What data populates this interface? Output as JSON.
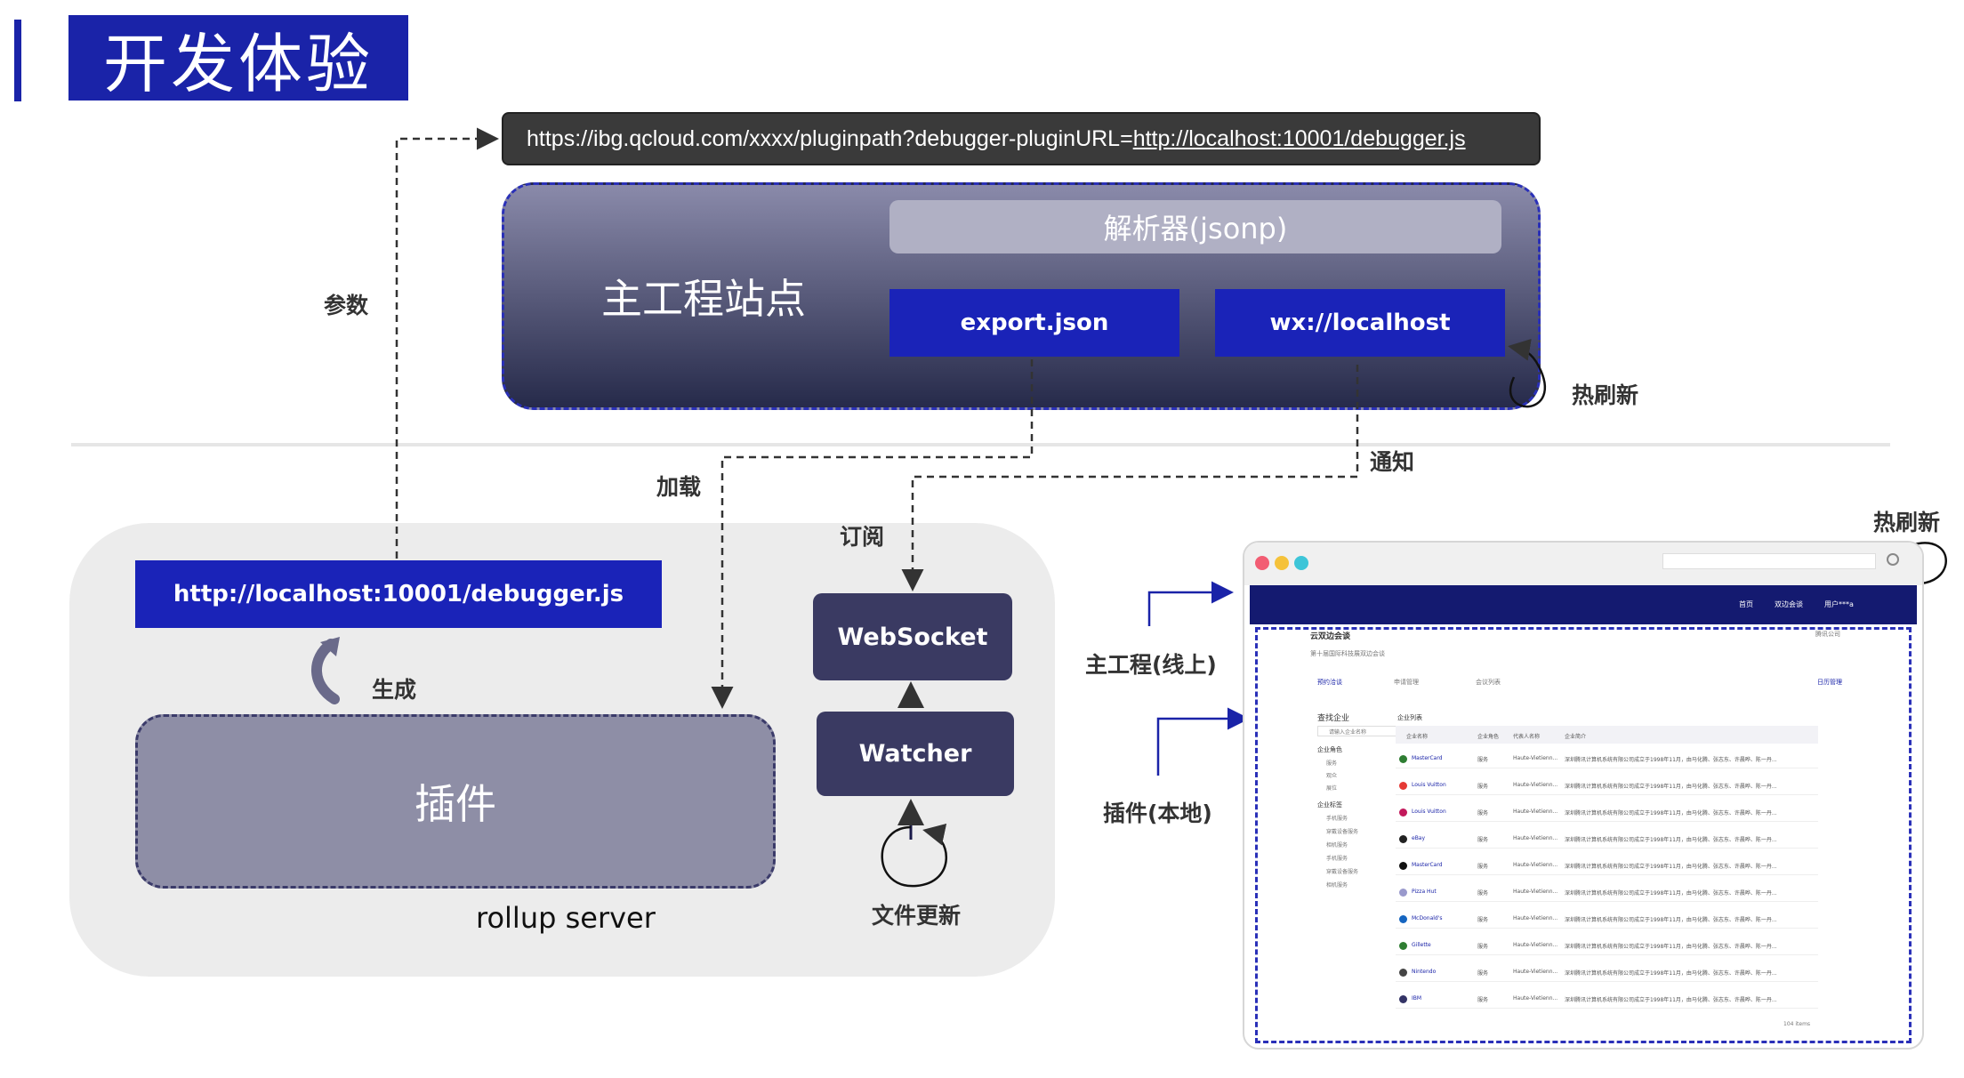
{
  "title": "开发体验",
  "url_bar": {
    "prefix": "https://ibg.qcloud.com/xxxx/pluginpath?debugger-pluginURL=",
    "link": "http://localhost:10001/debugger.js"
  },
  "main_site": {
    "title": "主工程站点",
    "parser": "解析器(jsonp)",
    "export": "export.json",
    "wx": "wx://localhost"
  },
  "labels": {
    "params": "参数",
    "hot_refresh": "热刷新",
    "load": "加载",
    "notify": "通知",
    "subscribe": "订阅",
    "generate": "生成",
    "file_update": "文件更新",
    "hot_refresh_2": "热刷新",
    "main_online": "主工程(线上)",
    "plugin_local": "插件(本地)"
  },
  "rollup": {
    "debugger_url": "http://localhost:10001/debugger.js",
    "plugin": "插件",
    "label": "rollup server",
    "websocket": "WebSocket",
    "watcher": "Watcher"
  },
  "colors": {
    "brand_blue": "#1a23a8",
    "dark_node": "#3a3a62",
    "traffic_red": "#f25d73",
    "traffic_yellow": "#f5c23a",
    "traffic_green": "#3dc5d8"
  },
  "screenshot": {
    "nav": [
      "首页",
      "双边会谈",
      "用户***a"
    ],
    "page_title": "云双边会谈",
    "page_subtitle": "第十届国际科技展双边会谈",
    "company": "腾讯公司",
    "tabs": [
      "预约洽谈",
      "申请管理",
      "会议列表"
    ],
    "tab_right": "日历管理",
    "sidebar": {
      "search_title": "查找企业",
      "search_placeholder": "请输入企业名称",
      "group1": "企业角色",
      "group1_items": [
        "服务",
        "观众",
        "展位"
      ],
      "group2": "企业标签",
      "group2_items": [
        "手机服务",
        "穿戴设备服务",
        "相机服务",
        "手机服务",
        "穿戴设备服务",
        "相机服务"
      ]
    },
    "table_title": "企业列表",
    "headers": [
      "企业名称",
      "企业角色",
      "代表人名称",
      "企业简介"
    ],
    "rows": [
      {
        "name": "MasterCard",
        "role": "服务",
        "rep": "Haute-Vietienn...",
        "desc": "深圳腾讯计算机系统有限公司成立于1998年11月，由马化腾、张志东、许晨晔、陈一丹...",
        "color": "#2e7d32"
      },
      {
        "name": "Louis Vuitton",
        "role": "服务",
        "rep": "Haute-Vietienn...",
        "desc": "深圳腾讯计算机系统有限公司成立于1998年11月，由马化腾、张志东、许晨晔、陈一丹...",
        "color": "#e53935"
      },
      {
        "name": "Louis Vuitton",
        "role": "服务",
        "rep": "Haute-Vietienn...",
        "desc": "深圳腾讯计算机系统有限公司成立于1998年11月，由马化腾、张志东、许晨晔、陈一丹...",
        "color": "#c2185b"
      },
      {
        "name": "eBay",
        "role": "服务",
        "rep": "Haute-Vietienn...",
        "desc": "深圳腾讯计算机系统有限公司成立于1998年11月，由马化腾、张志东、许晨晔、陈一丹...",
        "color": "#222222"
      },
      {
        "name": "MasterCard",
        "role": "服务",
        "rep": "Haute-Vietienn...",
        "desc": "深圳腾讯计算机系统有限公司成立于1998年11月，由马化腾、张志东、许晨晔、陈一丹...",
        "color": "#111111"
      },
      {
        "name": "Pizza Hut",
        "role": "服务",
        "rep": "Haute-Vietienn...",
        "desc": "深圳腾讯计算机系统有限公司成立于1998年11月，由马化腾、张志东、许晨晔、陈一丹...",
        "color": "#9999cc"
      },
      {
        "name": "McDonald's",
        "role": "服务",
        "rep": "Haute-Vietienn...",
        "desc": "深圳腾讯计算机系统有限公司成立于1998年11月，由马化腾、张志东、许晨晔、陈一丹...",
        "color": "#1565c0"
      },
      {
        "name": "Gillette",
        "role": "服务",
        "rep": "Haute-Vietienn...",
        "desc": "深圳腾讯计算机系统有限公司成立于1998年11月，由马化腾、张志东、许晨晔、陈一丹...",
        "color": "#2e7d32"
      },
      {
        "name": "Nintendo",
        "role": "服务",
        "rep": "Haute-Vietienn...",
        "desc": "深圳腾讯计算机系统有限公司成立于1998年11月，由马化腾、张志东、许晨晔、陈一丹...",
        "color": "#444444"
      },
      {
        "name": "IBM",
        "role": "服务",
        "rep": "Haute-Vietienn...",
        "desc": "深圳腾讯计算机系统有限公司成立于1998年11月，由马化腾、张志东、许晨晔、陈一丹...",
        "color": "#333366"
      }
    ],
    "pagination": "104 items"
  }
}
